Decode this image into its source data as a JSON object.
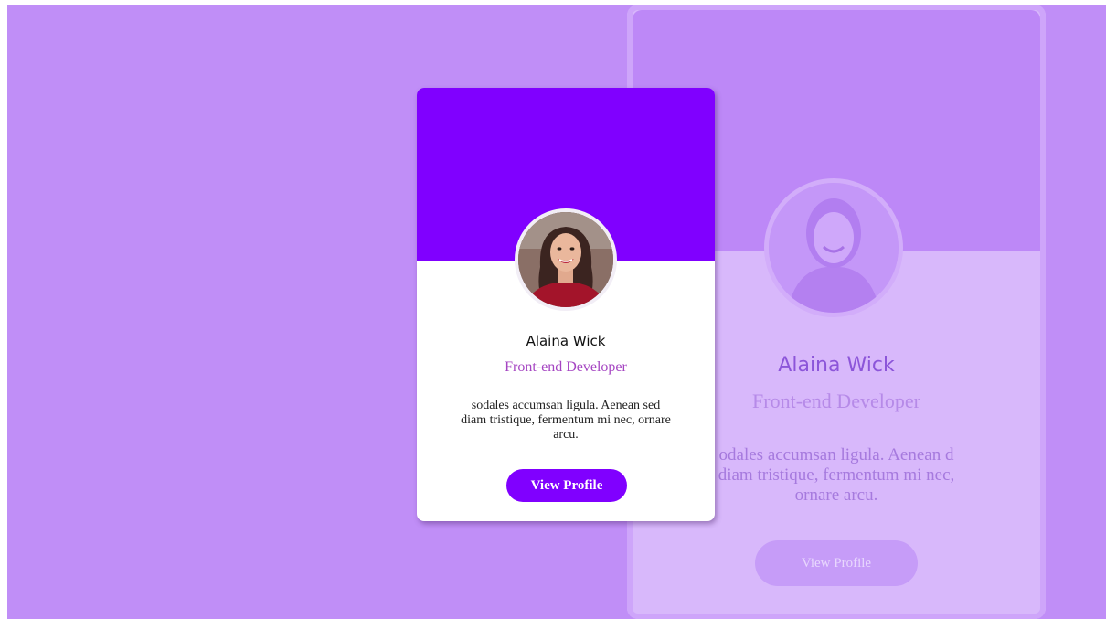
{
  "colors": {
    "page_background": "#c08ef7",
    "accent": "#8000ff",
    "role_text": "#a545c2"
  },
  "profile_card": {
    "avatar_icon": "avatar-photo",
    "name": "Alaina Wick",
    "role": "Front-end Developer",
    "description": "sodales accumsan ligula. Aenean sed diam tristique, fermentum mi nec, ornare arcu.",
    "button_label": "View Profile"
  },
  "ghost_card": {
    "name": "Alaina Wick",
    "role": "Front-end Developer",
    "description": "odales accumsan ligula. Aenean d diam tristique, fermentum mi nec, ornare arcu.",
    "button_label": "View Profile"
  }
}
